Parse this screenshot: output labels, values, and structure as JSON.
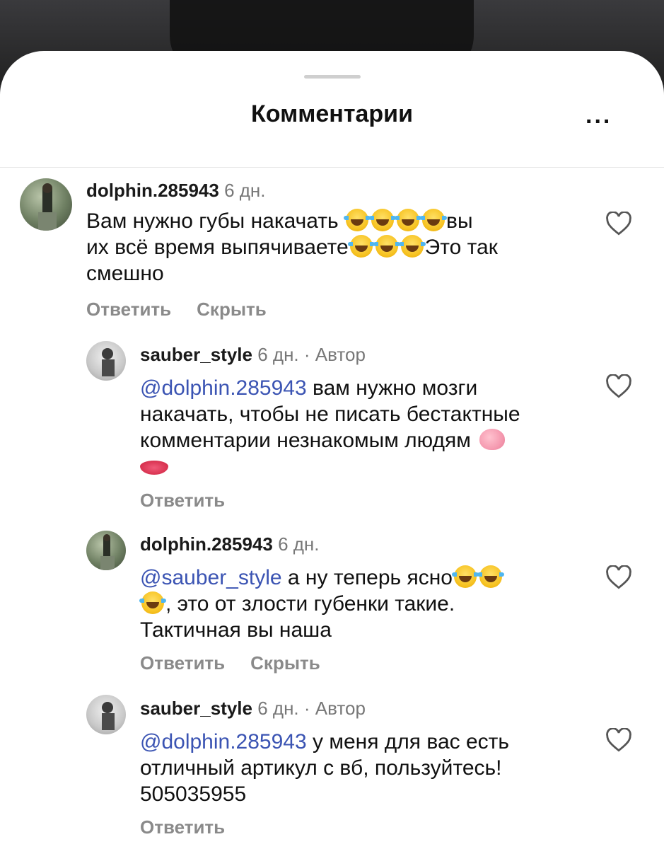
{
  "header": {
    "title": "Комментарии",
    "more_label": "..."
  },
  "comments": [
    {
      "username": "dolphin.285943",
      "time": "6 дн.",
      "text_parts": [
        "Вам нужно губы накачать ",
        "вы",
        "их всё время выпячиваете",
        "Это так",
        "смешно"
      ],
      "actions": [
        "Ответить",
        "Скрыть"
      ]
    },
    {
      "username": "sauber_style",
      "time": "6 дн.",
      "separator": "·",
      "badge": "Автор",
      "mention": "@dolphin.285943",
      "text_parts": [
        " вам нужно мозги",
        "накачать, чтобы не писать бестактные",
        "комментарии незнакомым людям "
      ],
      "actions": [
        "Ответить"
      ]
    },
    {
      "username": "dolphin.285943",
      "time": "6 дн.",
      "mention": "@sauber_style",
      "text_parts": [
        " а ну теперь ясно",
        ", это от злости губенки такие.",
        "Тактичная вы наша"
      ],
      "actions": [
        "Ответить",
        "Скрыть"
      ]
    },
    {
      "username": "sauber_style",
      "time": "6 дн.",
      "separator": "·",
      "badge": "Автор",
      "mention": "@dolphin.285943",
      "text_parts": [
        " у меня для вас есть",
        "отличный артикул с вб, пользуйтесь!",
        "505035955"
      ],
      "actions": [
        "Ответить"
      ]
    }
  ],
  "icons": {
    "like": "heart-outline-icon",
    "more": "more-dots-icon"
  },
  "colors": {
    "mention": "#3b54b3",
    "action": "#8a8a8a",
    "meta": "#777777"
  }
}
